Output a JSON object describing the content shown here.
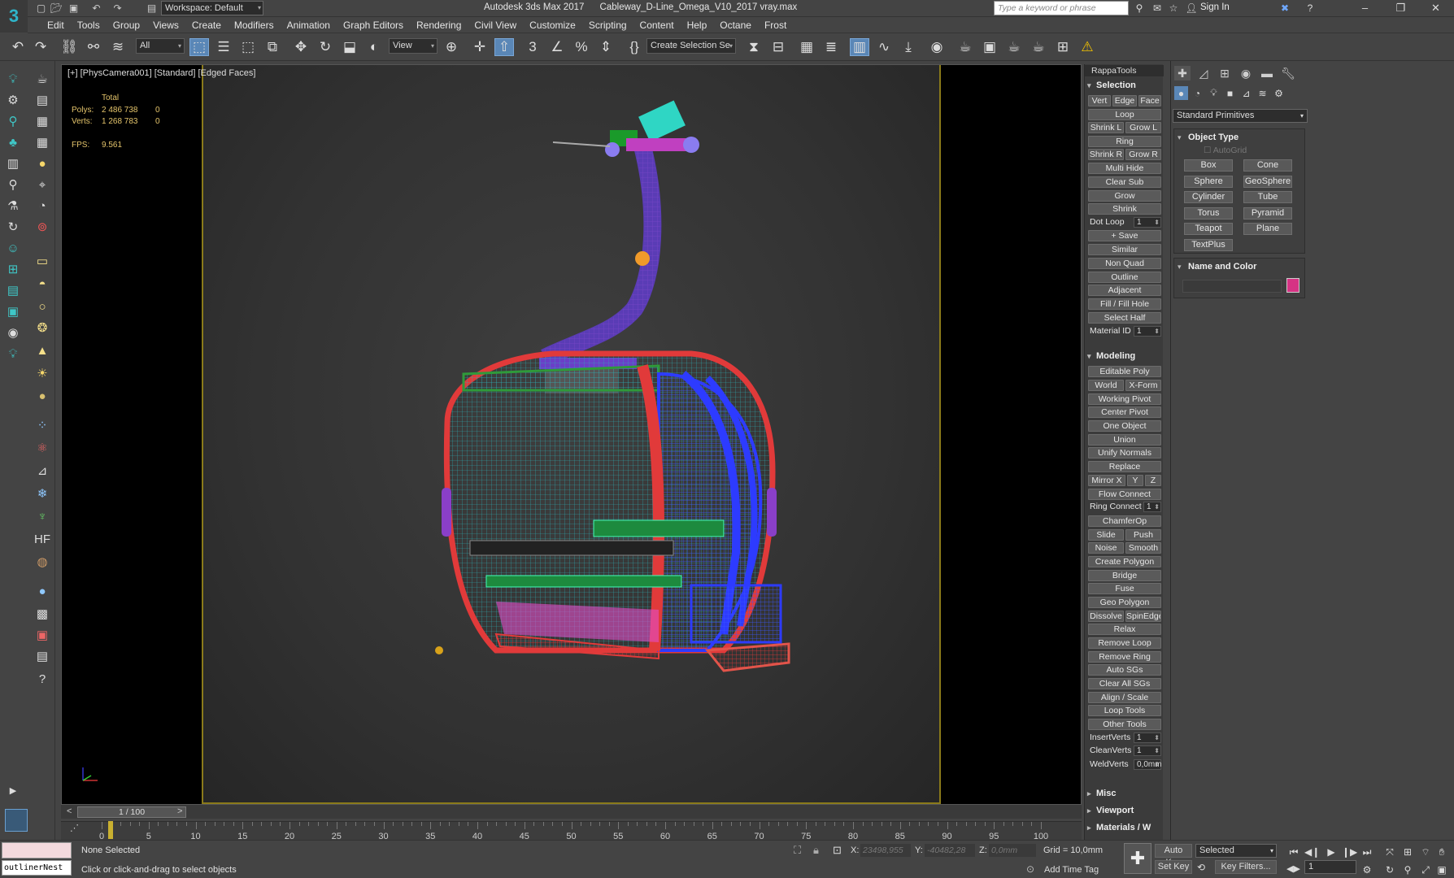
{
  "titlebar": {
    "workspace": "Workspace: Default",
    "title": "Autodesk 3ds Max 2017      Cableway_D-Line_Omega_V10_2017 vray.max",
    "search_placeholder": "Type a keyword or phrase",
    "signin": "Sign In"
  },
  "menu": [
    "Edit",
    "Tools",
    "Group",
    "Views",
    "Create",
    "Modifiers",
    "Animation",
    "Graph Editors",
    "Rendering",
    "Civil View",
    "Customize",
    "Scripting",
    "Content",
    "Help",
    "Octane",
    "Frost"
  ],
  "toolbar": {
    "selection_filter": "All",
    "ref_coord": "View",
    "named_selection": "Create Selection Se"
  },
  "viewport": {
    "label": "[+] [PhysCamera001] [Standard] [Edged Faces]",
    "stats": {
      "total_label": "Total",
      "polys_label": "Polys:",
      "polys_total": "2 486 738",
      "polys_sel": "0",
      "verts_label": "Verts:",
      "verts_total": "1 268 783",
      "verts_sel": "0",
      "fps_label": "FPS:",
      "fps": "9.561"
    }
  },
  "timeline": {
    "frame": "1 / 100",
    "ticks": [
      "0",
      "5",
      "10",
      "15",
      "20",
      "25",
      "30",
      "35",
      "40",
      "45",
      "50",
      "55",
      "60",
      "65",
      "70",
      "75",
      "80",
      "85",
      "90",
      "95",
      "100"
    ]
  },
  "status": {
    "maxscript": "outlinerNest",
    "selection": "None Selected",
    "hint": "Click or click-and-drag to select objects",
    "x_label": "X:",
    "x_val": "23498,955",
    "y_label": "Y:",
    "y_val": "-40482,28",
    "z_label": "Z:",
    "z_val": "0,0mm",
    "grid": "Grid = 10,0mm",
    "add_time_tag": "Add Time Tag",
    "auto_key": "Auto Key",
    "set_key": "Set Key",
    "selected": "Selected",
    "key_filters": "Key Filters...",
    "frame_field": "1"
  },
  "rappa": {
    "title": "RappaTools",
    "selection_label": "Selection",
    "modeling_label": "Modeling",
    "misc_label": "Misc",
    "viewport_label": "Viewport",
    "materials_label": "Materials / W",
    "selection": {
      "vert": "Vert",
      "edge": "Edge",
      "face": "Face",
      "loop": "Loop",
      "shrinkl": "Shrink L",
      "growl": "Grow L",
      "ring": "Ring",
      "shrinkr": "Shrink R",
      "growr": "Grow R",
      "multihide": "Multi Hide",
      "clearsub": "Clear Sub",
      "grow": "Grow",
      "shrink": "Shrink",
      "dotloop": "Dot Loop",
      "dotloop_val": "1",
      "save": "+ Save",
      "similar": "Similar",
      "nonquad": "Non Quad",
      "outline": "Outline",
      "adjacent": "Adjacent",
      "fillhole": "Fill / Fill Hole",
      "selecthalf": "Select Half",
      "matid": "Material ID",
      "matid_val": "1"
    },
    "modeling": {
      "editpoly": "Editable Poly",
      "world": "World",
      "xform": "X-Form",
      "workingpivot": "Working Pivot",
      "centerpivot": "Center Pivot",
      "oneobject": "One Object",
      "union": "Union",
      "unifynormals": "Unify Normals",
      "replace": "Replace",
      "mirrorx": "Mirror X",
      "mirrory": "Y",
      "mirrorz": "Z",
      "flowconnect": "Flow Connect",
      "ringconnect": "Ring Connect",
      "ringconnect_val": "1",
      "chamferop": "ChamferOp",
      "slide": "Slide",
      "push": "Push",
      "noise": "Noise",
      "smooth": "Smooth",
      "createpolygon": "Create Polygon",
      "bridge": "Bridge",
      "fuse": "Fuse",
      "geopolygon": "Geo Polygon",
      "dissolve": "Dissolve",
      "spinedge": "SpinEdge",
      "relax": "Relax",
      "removeloop": "Remove Loop",
      "removering": "Remove Ring",
      "autosgs": "Auto SGs",
      "clearsgs": "Clear All SGs",
      "alignscale": "Align / Scale",
      "looptools": "Loop Tools",
      "othertools": "Other Tools",
      "insertverts": "InsertVerts",
      "insertverts_val": "1",
      "cleanverts": "CleanVerts",
      "cleanverts_val": "1",
      "weldverts": "WeldVerts",
      "weldverts_val": "0,0mm"
    }
  },
  "command_panel": {
    "dropdown": "Standard Primitives",
    "object_type_title": "Object Type",
    "autogrid": "AutoGrid",
    "primitives": [
      "Box",
      "Cone",
      "Sphere",
      "GeoSphere",
      "Cylinder",
      "Tube",
      "Torus",
      "Pyramid",
      "Teapot",
      "Plane",
      "TextPlus"
    ],
    "name_color_title": "Name and Color",
    "object_color": "#d63384"
  },
  "colors": {
    "accent": "#5a87b7",
    "safe_frame": "#8a7a1a",
    "stats_text": "#e4c46b"
  }
}
